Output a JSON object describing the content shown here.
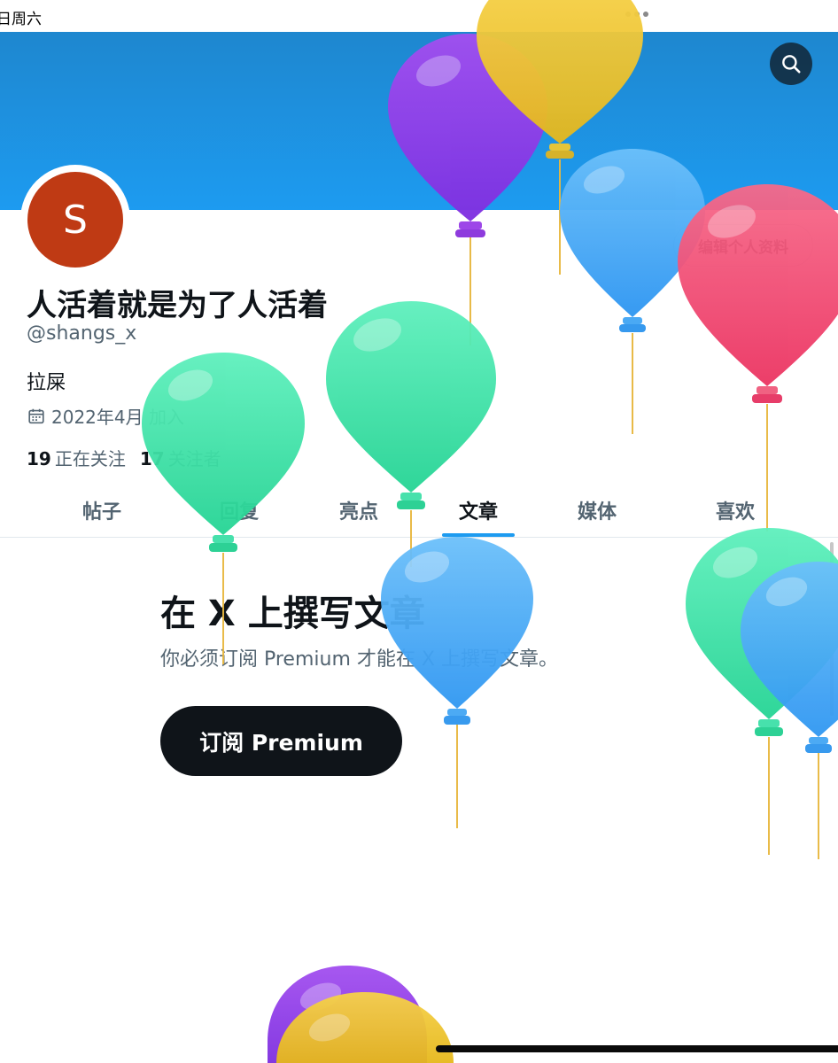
{
  "status_bar": {
    "date": "日周六"
  },
  "header": {
    "search_icon": "search-icon",
    "banner_color": "#1d9bf0"
  },
  "profile": {
    "avatar_letter": "S",
    "avatar_color": "#bf3a14",
    "edit_button": "编辑个人资料",
    "display_name": "人活着就是为了人活着",
    "handle": "@shangs_x",
    "bio": "拉屎",
    "joined": "2022年4月 加入",
    "calendar_icon": "calendar-icon",
    "following_count": "19",
    "following_label": "正在关注",
    "followers_count": "17",
    "followers_label": "关注者"
  },
  "tabs": [
    {
      "label": "帖子"
    },
    {
      "label": "回复"
    },
    {
      "label": "亮点"
    },
    {
      "label": "文章",
      "active": true
    },
    {
      "label": "媒体"
    },
    {
      "label": "喜欢"
    }
  ],
  "articles_empty": {
    "title": "在 X 上撰写文章",
    "subtitle": "你必须订阅 Premium 才能在 X 上撰写文章。",
    "cta": "订阅 Premium"
  },
  "overlay": {
    "type": "balloon-animation",
    "colors": [
      "#8e44e8",
      "#f2c230",
      "#4ab0f5",
      "#f0456f",
      "#3ee0a8"
    ]
  },
  "theme": {
    "accent": "#1d9bf0",
    "text_primary": "#0f1419",
    "text_secondary": "#536471"
  }
}
